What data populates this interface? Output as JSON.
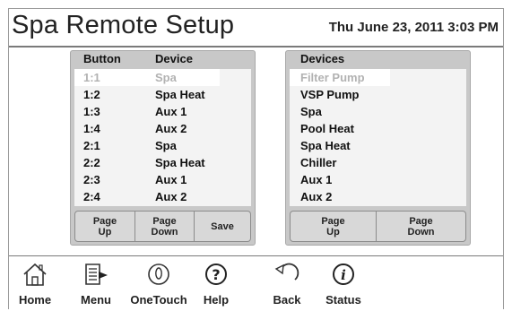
{
  "header": {
    "title": "Spa Remote Setup",
    "datetime": "Thu June 23, 2011  3:03 PM"
  },
  "remote_panel": {
    "col_button": "Button",
    "col_device": "Device",
    "rows": [
      {
        "button": "1:1",
        "device": "Spa",
        "selected": true
      },
      {
        "button": "1:2",
        "device": "Spa Heat",
        "selected": false
      },
      {
        "button": "1:3",
        "device": "Aux 1",
        "selected": false
      },
      {
        "button": "1:4",
        "device": "Aux 2",
        "selected": false
      },
      {
        "button": "2:1",
        "device": "Spa",
        "selected": false
      },
      {
        "button": "2:2",
        "device": "Spa Heat",
        "selected": false
      },
      {
        "button": "2:3",
        "device": "Aux 1",
        "selected": false
      },
      {
        "button": "2:4",
        "device": "Aux 2",
        "selected": false
      }
    ],
    "page_up": {
      "line1": "Page",
      "line2": "Up"
    },
    "page_down": {
      "line1": "Page",
      "line2": "Down"
    },
    "save": "Save"
  },
  "devices_panel": {
    "header": "Devices",
    "items": [
      {
        "label": "Filter Pump",
        "selected": true
      },
      {
        "label": "VSP Pump",
        "selected": false
      },
      {
        "label": "Spa",
        "selected": false
      },
      {
        "label": "Pool Heat",
        "selected": false
      },
      {
        "label": "Spa Heat",
        "selected": false
      },
      {
        "label": "Chiller",
        "selected": false
      },
      {
        "label": "Aux 1",
        "selected": false
      },
      {
        "label": "Aux 2",
        "selected": false
      }
    ],
    "page_up": {
      "line1": "Page",
      "line2": "Up"
    },
    "page_down": {
      "line1": "Page",
      "line2": "Down"
    }
  },
  "nav": [
    {
      "label": "Home",
      "icon": "home-icon"
    },
    {
      "label": "Menu",
      "icon": "menu-icon"
    },
    {
      "label": "OneTouch",
      "icon": "onetouch-icon"
    },
    {
      "label": "Help",
      "icon": "help-icon"
    },
    {
      "label": "Back",
      "icon": "back-icon"
    },
    {
      "label": "Status",
      "icon": "status-icon"
    }
  ]
}
